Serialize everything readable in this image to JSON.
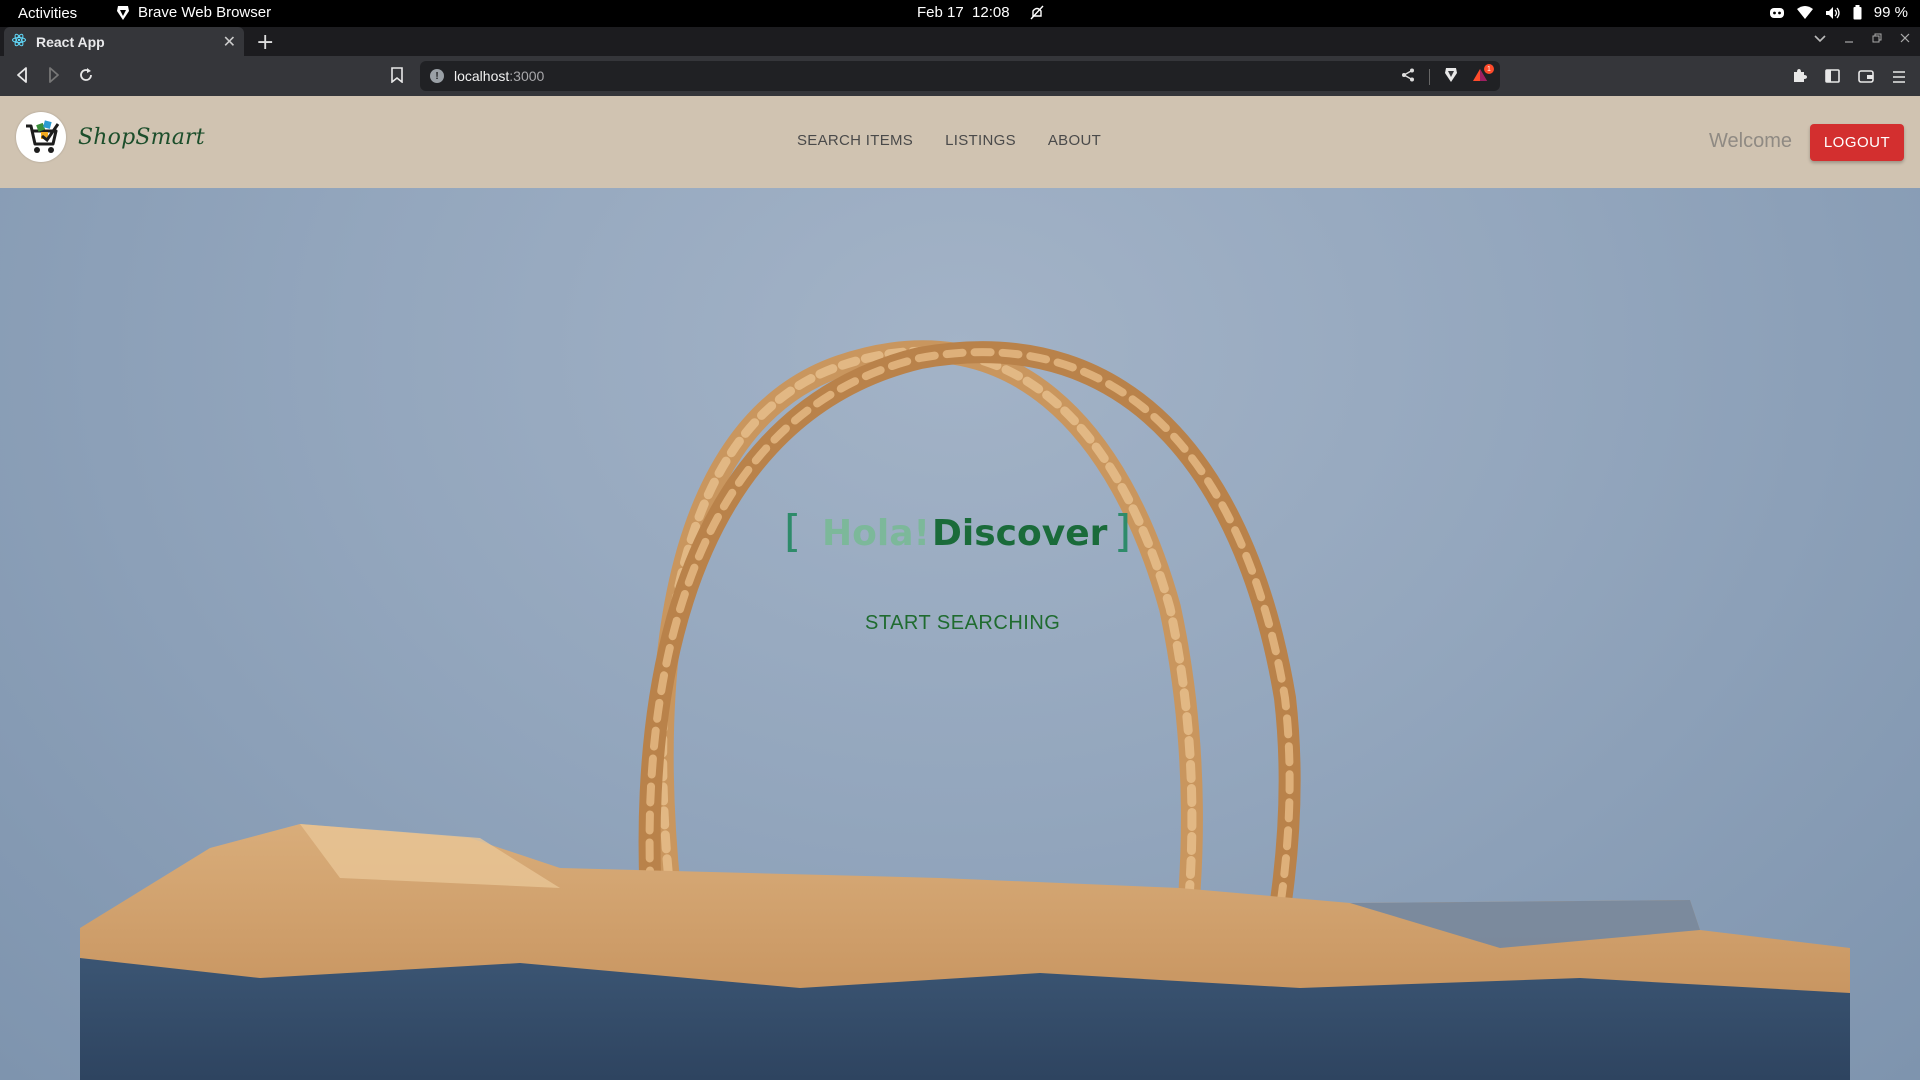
{
  "system_bar": {
    "activities": "Activities",
    "app_name": "Brave Web Browser",
    "date": "Feb 17",
    "time": "12:08",
    "battery": "99 %"
  },
  "browser": {
    "tab_title": "React App",
    "url_host": "localhost",
    "url_port": ":3000"
  },
  "app": {
    "brand": "ShopSmart",
    "nav": [
      "SEARCH ITEMS",
      "LISTINGS",
      "ABOUT"
    ],
    "welcome": "Welcome",
    "logout_label": "LOGOUT",
    "hero": {
      "bracket_left": "[",
      "greeting": "Hola!",
      "word": "Discover",
      "bracket_right": "]",
      "cta": "START SEARCHING"
    }
  },
  "colors": {
    "nav_bg": "#d0c3b1",
    "logout_bg": "#d32f2f",
    "headline_green": "#1a6b3a",
    "greeting_green": "#7cb89a",
    "cta_green": "#1f6b2f"
  }
}
